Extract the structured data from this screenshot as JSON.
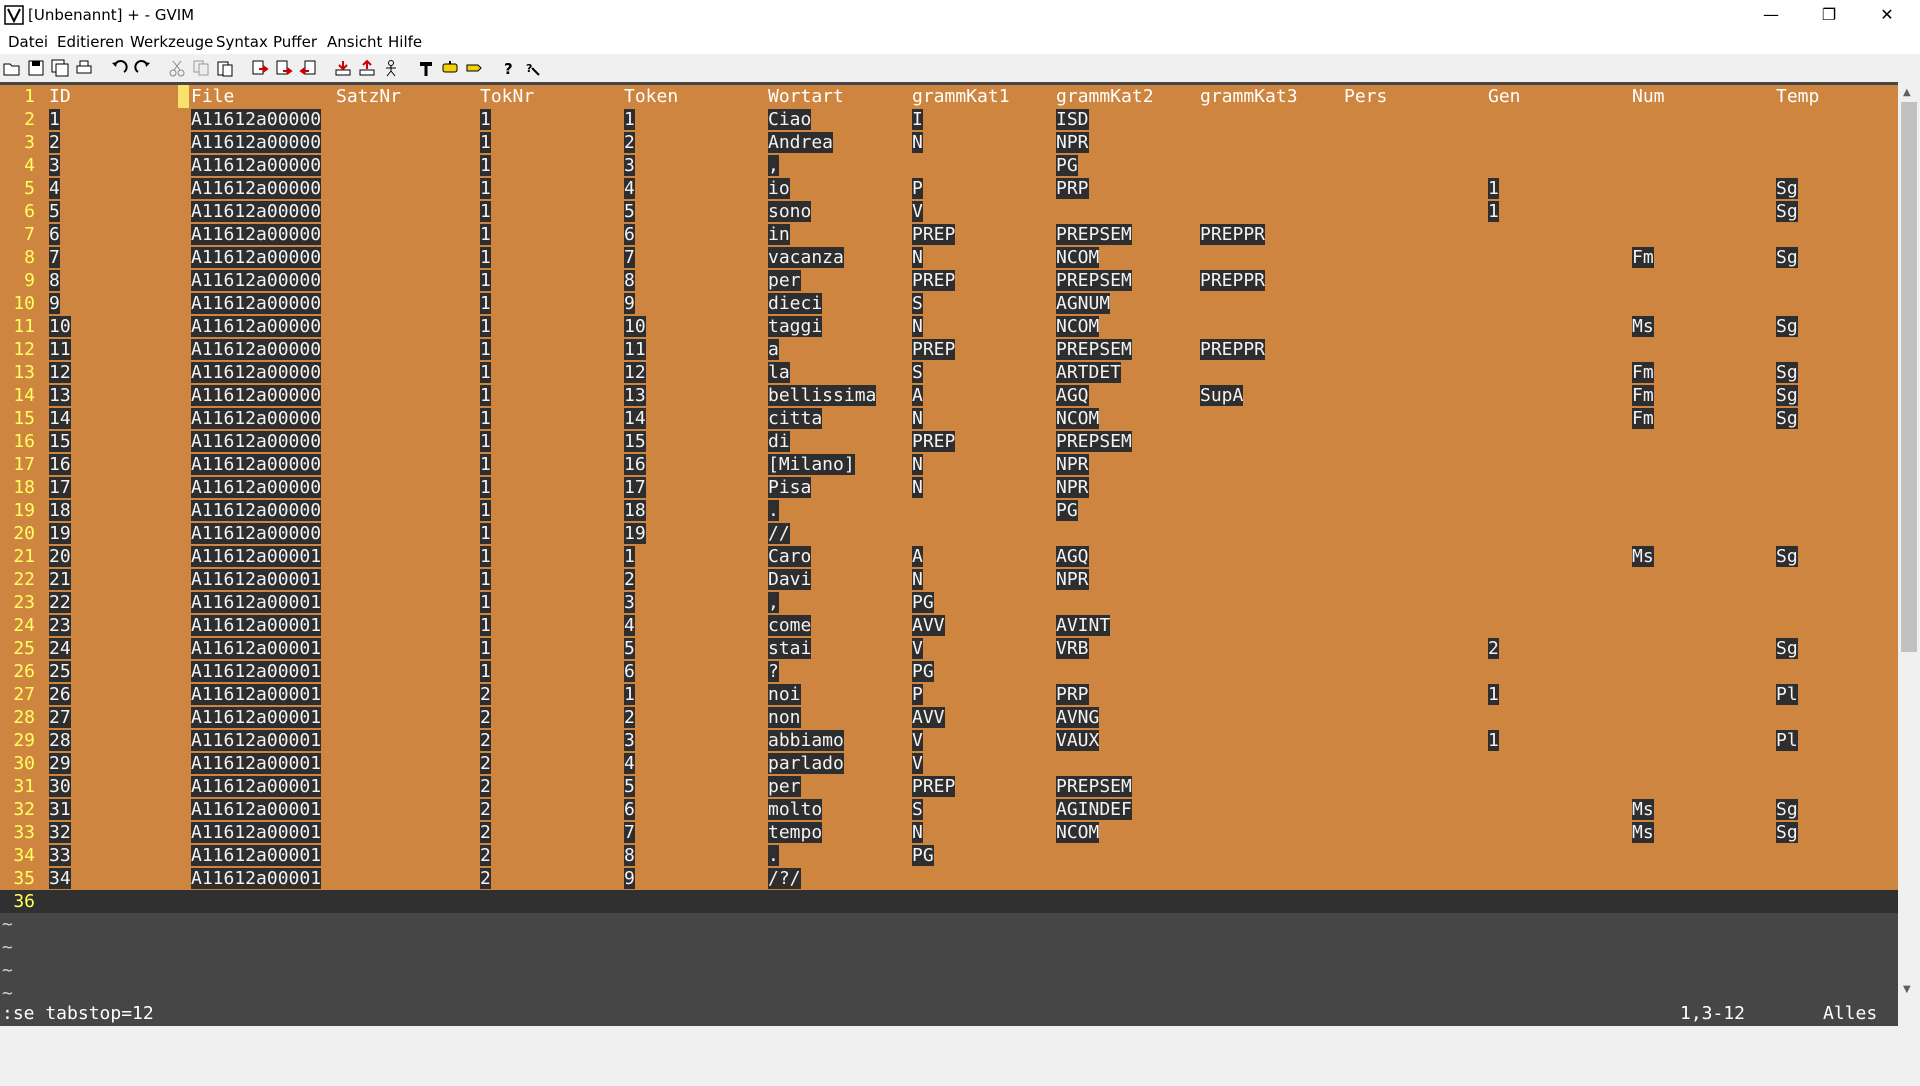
{
  "window": {
    "title": "[Unbenannt] + - GVIM",
    "minimize": "—",
    "maximize": "❐",
    "close": "✕"
  },
  "menu": [
    "Datei",
    "Editieren",
    "Werkzeuge",
    "Syntax",
    "Puffer",
    "Ansicht",
    "Hilfe"
  ],
  "toolbar": [
    "open-icon",
    "save-icon",
    "save-all-icon",
    "print-icon",
    "undo-icon",
    "redo-icon",
    "cut-icon",
    "copy-icon",
    "paste-icon",
    "replace-icon",
    "find-next-icon",
    "find-prev-icon",
    "load-session-icon",
    "save-session-icon",
    "run-script-icon",
    "make-icon",
    "run-ctags-icon",
    "tag-jump-icon",
    "help-icon",
    "find-help-icon"
  ],
  "colors": {
    "highlight": "#cd853f",
    "text_bg": "#2e2e2e",
    "line_number": "#ffff60",
    "editor_bg": "#464646"
  },
  "columns": [
    "ID",
    "File",
    "SatzNr",
    "TokNr",
    "Token",
    "Wortart",
    "grammKat1",
    "grammKat2",
    "grammKat3",
    "Pers",
    "Gen",
    "Num",
    "Temp"
  ],
  "rows": [
    [
      "1",
      "A11612a00000",
      "",
      "1",
      "1",
      "Ciao",
      "I",
      "ISD",
      "",
      "",
      "",
      "",
      ""
    ],
    [
      "2",
      "A11612a00000",
      "",
      "1",
      "2",
      "Andrea",
      "N",
      "NPR",
      "",
      "",
      "",
      "",
      ""
    ],
    [
      "3",
      "A11612a00000",
      "",
      "1",
      "3",
      ",",
      "",
      "PG",
      "",
      "",
      "",
      "",
      ""
    ],
    [
      "4",
      "A11612a00000",
      "",
      "1",
      "4",
      "io",
      "P",
      "PRP",
      "",
      "",
      "1",
      "",
      "Sg"
    ],
    [
      "5",
      "A11612a00000",
      "",
      "1",
      "5",
      "sono",
      "V",
      "",
      "",
      "",
      "1",
      "",
      "Sg"
    ],
    [
      "6",
      "A11612a00000",
      "",
      "1",
      "6",
      "in",
      "PREP",
      "PREPSEM",
      "PREPPR",
      "",
      "",
      "",
      ""
    ],
    [
      "7",
      "A11612a00000",
      "",
      "1",
      "7",
      "vacanza",
      "N",
      "NCOM",
      "",
      "",
      "",
      "Fm",
      "Sg"
    ],
    [
      "8",
      "A11612a00000",
      "",
      "1",
      "8",
      "per",
      "PREP",
      "PREPSEM",
      "PREPPR",
      "",
      "",
      "",
      ""
    ],
    [
      "9",
      "A11612a00000",
      "",
      "1",
      "9",
      "dieci",
      "S",
      "AGNUM",
      "",
      "",
      "",
      "",
      ""
    ],
    [
      "10",
      "A11612a00000",
      "",
      "1",
      "10",
      "taggi",
      "N",
      "NCOM",
      "",
      "",
      "",
      "Ms",
      "Sg"
    ],
    [
      "11",
      "A11612a00000",
      "",
      "1",
      "11",
      "a",
      "PREP",
      "PREPSEM",
      "PREPPR",
      "",
      "",
      "",
      ""
    ],
    [
      "12",
      "A11612a00000",
      "",
      "1",
      "12",
      "la",
      "S",
      "ARTDET",
      "",
      "",
      "",
      "Fm",
      "Sg"
    ],
    [
      "13",
      "A11612a00000",
      "",
      "1",
      "13",
      "bellissima",
      "A",
      "AGQ",
      "SupA",
      "",
      "",
      "Fm",
      "Sg"
    ],
    [
      "14",
      "A11612a00000",
      "",
      "1",
      "14",
      "citta",
      "N",
      "NCOM",
      "",
      "",
      "",
      "Fm",
      "Sg"
    ],
    [
      "15",
      "A11612a00000",
      "",
      "1",
      "15",
      "di",
      "PREP",
      "PREPSEM",
      "",
      "",
      "",
      "",
      ""
    ],
    [
      "16",
      "A11612a00000",
      "",
      "1",
      "16",
      "[Milano]",
      "N",
      "NPR",
      "",
      "",
      "",
      "",
      ""
    ],
    [
      "17",
      "A11612a00000",
      "",
      "1",
      "17",
      "Pisa",
      "N",
      "NPR",
      "",
      "",
      "",
      "",
      ""
    ],
    [
      "18",
      "A11612a00000",
      "",
      "1",
      "18",
      ".",
      "",
      "PG",
      "",
      "",
      "",
      "",
      ""
    ],
    [
      "19",
      "A11612a00000",
      "",
      "1",
      "19",
      "//",
      "",
      "",
      "",
      "",
      "",
      "",
      ""
    ],
    [
      "20",
      "A11612a00001",
      "",
      "1",
      "1",
      "Caro",
      "A",
      "AGQ",
      "",
      "",
      "",
      "Ms",
      "Sg"
    ],
    [
      "21",
      "A11612a00001",
      "",
      "1",
      "2",
      "Davi",
      "N",
      "NPR",
      "",
      "",
      "",
      "",
      ""
    ],
    [
      "22",
      "A11612a00001",
      "",
      "1",
      "3",
      ",",
      "PG",
      "",
      "",
      "",
      "",
      "",
      ""
    ],
    [
      "23",
      "A11612a00001",
      "",
      "1",
      "4",
      "come",
      "AVV",
      "AVINT",
      "",
      "",
      "",
      "",
      ""
    ],
    [
      "24",
      "A11612a00001",
      "",
      "1",
      "5",
      "stai",
      "V",
      "VRB",
      "",
      "",
      "2",
      "",
      "Sg"
    ],
    [
      "25",
      "A11612a00001",
      "",
      "1",
      "6",
      "?",
      "PG",
      "",
      "",
      "",
      "",
      "",
      ""
    ],
    [
      "26",
      "A11612a00001",
      "",
      "2",
      "1",
      "noi",
      "P",
      "PRP",
      "",
      "",
      "1",
      "",
      "Pl"
    ],
    [
      "27",
      "A11612a00001",
      "",
      "2",
      "2",
      "non",
      "AVV",
      "AVNG",
      "",
      "",
      "",
      "",
      ""
    ],
    [
      "28",
      "A11612a00001",
      "",
      "2",
      "3",
      "abbiamo",
      "V",
      "VAUX",
      "",
      "",
      "1",
      "",
      "Pl"
    ],
    [
      "29",
      "A11612a00001",
      "",
      "2",
      "4",
      "parlado",
      "V",
      "",
      "",
      "",
      "",
      "",
      ""
    ],
    [
      "30",
      "A11612a00001",
      "",
      "2",
      "5",
      "per",
      "PREP",
      "PREPSEM",
      "",
      "",
      "",
      "",
      ""
    ],
    [
      "31",
      "A11612a00001",
      "",
      "2",
      "6",
      "molto",
      "S",
      "AGINDEF",
      "",
      "",
      "",
      "Ms",
      "Sg"
    ],
    [
      "32",
      "A11612a00001",
      "",
      "2",
      "7",
      "tempo",
      "N",
      "NCOM",
      "",
      "",
      "",
      "Ms",
      "Sg"
    ],
    [
      "33",
      "A11612a00001",
      "",
      "2",
      "8",
      ".",
      "PG",
      "",
      "",
      "",
      "",
      "",
      ""
    ],
    [
      "34",
      "A11612a00001",
      "",
      "2",
      "9",
      "/?/",
      "",
      "",
      "",
      "",
      "",
      "",
      ""
    ]
  ],
  "last_line_number": "36",
  "tilde": "~",
  "command": ":se tabstop=12",
  "position": "1,3-12",
  "scroll_state": "Alles"
}
